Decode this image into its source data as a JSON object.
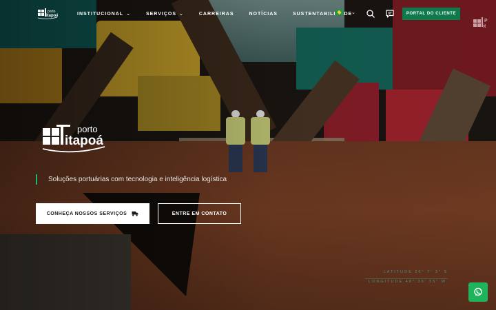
{
  "header": {
    "logo_alt": "porto itapoá",
    "nav": [
      {
        "label": "Institucional",
        "has_dropdown": true
      },
      {
        "label": "Serviços",
        "has_dropdown": true
      },
      {
        "label": "Carreiras",
        "has_dropdown": false
      },
      {
        "label": "Notícias",
        "has_dropdown": false
      },
      {
        "label": "Sustentabilidade",
        "has_dropdown": false
      }
    ],
    "language": {
      "flag": "brazil-flag",
      "selected": "PT-BR"
    },
    "icons": [
      "search-icon",
      "chat-bubble-icon"
    ],
    "portal_button": "Portal do Cliente"
  },
  "hero": {
    "logo_text_top": "porto",
    "logo_text_bottom": "itapoá",
    "tagline": "Soluções portuárias com tecnologia e inteligência logística",
    "primary_button": "Conheça nossos serviços",
    "secondary_button": "Entre em contato",
    "coords": {
      "latitude": "Latitude 26° 7' 3\" S",
      "longitude": "Longitude 48° 36' 55\" W"
    }
  },
  "colors": {
    "accent_green": "#0f7a4c",
    "tagline_bar": "#1bb871",
    "chat_green": "#1fb35c",
    "coords_text": "#4f8f7d"
  },
  "chat": {
    "icon": "whatsapp-icon"
  }
}
